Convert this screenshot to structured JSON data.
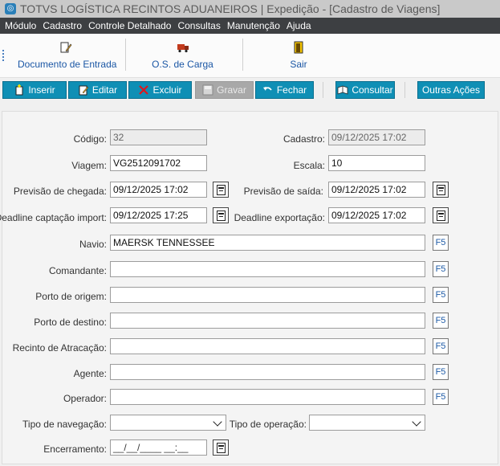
{
  "window": {
    "title": "TOTVS LOGÍSTICA RECINTOS ADUANEIROS | Expedição - [Cadastro de Viagens]"
  },
  "menu": [
    "Módulo",
    "Cadastro",
    "Controle Detalhado",
    "Consultas",
    "Manutenção",
    "Ajuda"
  ],
  "shortcuts": {
    "doc_entrada": "Documento de Entrada",
    "os_carga": "O.S. de Carga",
    "sair": "Sair"
  },
  "toolbar": {
    "inserir": "Inserir",
    "editar": "Editar",
    "excluir": "Excluir",
    "gravar": "Gravar",
    "fechar": "Fechar",
    "consultar": "Consultar",
    "outras": "Outras Ações"
  },
  "form": {
    "codigo": {
      "label": "Código:",
      "value": "32"
    },
    "cadastro": {
      "label": "Cadastro:",
      "value": "09/12/2025 17:02"
    },
    "viagem": {
      "label": "Viagem:",
      "value": "VG2512091702"
    },
    "escala": {
      "label": "Escala:",
      "value": "10"
    },
    "previsao_chegada": {
      "label": "Previsão de chegada:",
      "value": "09/12/2025 17:02"
    },
    "previsao_saida": {
      "label": "Previsão de saída:",
      "value": "09/12/2025 17:02"
    },
    "deadline_import": {
      "label": "Deadline captação import:",
      "value": "09/12/2025 17:25"
    },
    "deadline_export": {
      "label": "Deadline exportação:",
      "value": "09/12/2025 17:02"
    },
    "navio": {
      "label": "Navio:",
      "value": "MAERSK TENNESSEE"
    },
    "comandante": {
      "label": "Comandante:",
      "value": ""
    },
    "porto_origem": {
      "label": "Porto de origem:",
      "value": ""
    },
    "porto_destino": {
      "label": "Porto de destino:",
      "value": ""
    },
    "recinto": {
      "label": "Recinto de Atracação:",
      "value": ""
    },
    "agente": {
      "label": "Agente:",
      "value": ""
    },
    "operador": {
      "label": "Operador:",
      "value": ""
    },
    "tipo_navegacao": {
      "label": "Tipo de navegação:",
      "value": ""
    },
    "tipo_operacao": {
      "label": "Tipo de operação:",
      "value": ""
    },
    "encerramento": {
      "label": "Encerramento:",
      "value": "__/__/____ __:__"
    },
    "f5_label": "F5"
  }
}
